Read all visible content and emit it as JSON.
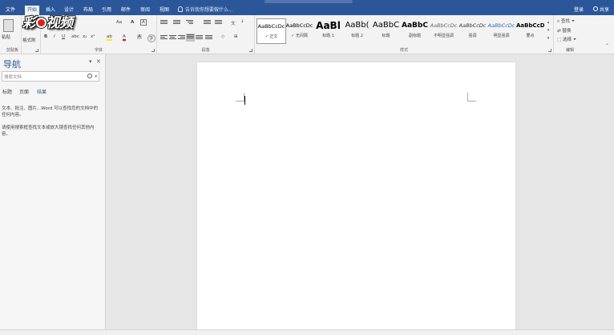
{
  "tabs": [
    "文件",
    "开始",
    "插入",
    "设计",
    "布局",
    "引用",
    "邮件",
    "审阅",
    "视图"
  ],
  "active_tab": "开始",
  "tell_me": "告诉我你想要做什么...",
  "account": {
    "signin": "登录",
    "share": "共享"
  },
  "watermark": "彩视频",
  "clipboard": {
    "paste": "粘贴",
    "format_painter": "格式刷",
    "label": "剪贴板"
  },
  "font": {
    "size_label": "Aa",
    "label": "字体"
  },
  "paragraph": {
    "label": "段落"
  },
  "styles": {
    "label": "样式",
    "items": [
      {
        "preview": "AaBbCcDc",
        "name": "正文",
        "selected": true
      },
      {
        "preview": "AaBbCcDc",
        "name": "无间隔"
      },
      {
        "preview": "AaBl",
        "name": "标题 1"
      },
      {
        "preview": "AaBb(",
        "name": "标题 2"
      },
      {
        "preview": "AaBbC",
        "name": "标题"
      },
      {
        "preview": "AaBbC",
        "name": "副标题"
      },
      {
        "preview": "AaBbCcDc",
        "name": "不明显强调"
      },
      {
        "preview": "AaBbCcDc",
        "name": "强调"
      },
      {
        "preview": "AaBbCcDc",
        "name": "明显强调"
      },
      {
        "preview": "AaBbCcD",
        "name": "要点"
      }
    ]
  },
  "editing": {
    "find": "查找",
    "replace": "替换",
    "select": "选择",
    "label": "编辑"
  },
  "nav": {
    "title": "导航",
    "search_placeholder": "搜索文档",
    "tabs": [
      "标题",
      "页面",
      "结果"
    ],
    "active_tab": "结果",
    "text1": "文本、批注、图片...Word 可以查找您的文档中的任何内容。",
    "text2": "请使用搜索框查找文本或放大镜查找任何其他内容。"
  }
}
